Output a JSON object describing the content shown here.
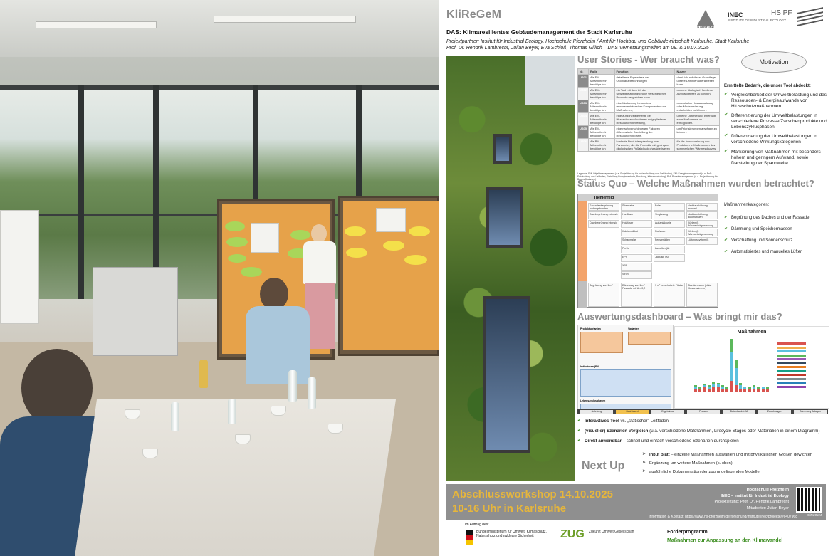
{
  "photo": {
    "description_hidden": ""
  },
  "poster": {
    "brand": "KliReGeM",
    "subtitle": "DAS: Klimaresilientes Gebäudemanagement der Stadt Karlsruhe",
    "partner_line": "Projektpartner: Institut für Industrial Ecology, Hochschule Pforzheim / Amt für Hochbau und Gebäudewirtschaft Karlsruhe, Stadt Karlsruhe",
    "author_line": "Prof. Dr. Hendrik Lambrecht, Julian Beyer, Eva Schloß, Thomas Gillich – DAS Vernetzungstreffen am 09. & 10.07.2025",
    "logos": {
      "karlsruhe": "Karlsruhe",
      "inec": "INEC",
      "inec_sub": "INSTITUTE OF INDUSTRIAL ECOLOGY",
      "hspf": "HS PF"
    },
    "sections": {
      "user_stories": "User Stories - Wer braucht was?",
      "status_quo": "Status Quo – Welche Maßnahmen wurden betrachtet?",
      "dashboard": "Auswertungsdashboard – Was bringt mir das?",
      "next_up": "Next Up"
    },
    "motivation": "Motivation",
    "user_story_table": {
      "headers": [
        "Nr.",
        "Rolle",
        "Funktion",
        "Nutzen"
      ],
      "rows": [
        [
          "US01",
          "Als EM-Mitarbeiter*in benötige ich",
          "detaillierte Ergebnisse der Ökobilanzberechnungen",
          "damit ich auf dieser Grundlage unsere Leitlinien überarbeiten kann."
        ],
        [
          "US02",
          "Als EM-Mitarbeiter*in benötige ich",
          "ein Tool mit dem ich die Umweltbelastungsprofile verschiedener Produkte vergleichen kann",
          "um eine ökologisch fundierte Auswahl treffen zu können."
        ],
        [
          "US03",
          "Als EM-Mitarbeiter*in benötige ich",
          "eine Markierung besonders ressourcenintensiver Komponenten von Maßnahmen,",
          "um zwischen Instandsetzung oder Modernisierung entscheiden zu können."
        ],
        [
          "US04",
          "Als EM-Mitarbeiter*in benötige ich",
          "eine auf Einzelelemente der Hitzeschutzmaßnahmen aufgegliederte Ressourcenbewertung,",
          "um eine Optimierung innerhalb einer Maßnahme zu ermöglichen."
        ],
        [
          "US05",
          "Als EM-Mitarbeiter*in benötige ich",
          "eine nach verschiedenen Faktoren differenzierte Darstellung der Ressourcenbedarfe,",
          "um Priorisierungen abwägen zu können."
        ],
        [
          "US06",
          "Als PM-Mitarbeiter*in benötige ich",
          "konkrete Produktempfehlung oder Parameter, die die Produkte mit geringem ökologischen Fußabdruck charakterisieren",
          "für die Ausschreibung von Produkten u. Maßnahmen des sommerlichen Wärmeschutzes."
        ]
      ],
      "legend": "Legende: EM: Objektmanagement (u.a. Projektierung für Instandhaltung von Gebäuden), EM: Energiemanagement (u.a. BnS: Entwicklung von Leitfaden, Erstellung Energieberichte, Beratung, Klimamonitoring), PM: Projektmanagement (u.a. Projektierung für Baumaßnahmen)"
    },
    "needs": {
      "heading": "Ermittelte Bedarfe, die unser Tool abdeckt:",
      "items": [
        "Vergleichbarkeit der Umweltbelastung und des Ressourcen- & Energieaufwands von Hitzeschutzmaßnahmen",
        "Differenzierung der Umweltbelastungen in verschiedene Prozesse/Zwischenprodukte und Lebenszyklusphasen",
        "Differenzierung der Umweltbelastungen in verschiedene Wirkungskategorien",
        "Markierung von Maßnahmen mit besonders hohem und geringem Aufwand, sowie Darstellung der Spannweite"
      ]
    },
    "status_grid": {
      "header": "Themenfeld",
      "columns": [
        "Begrünung",
        "Status",
        "Dämmung / Speichermasse",
        "Status",
        "Sonnenschutz",
        "Status",
        "Lüften",
        "Status"
      ],
      "rows": [
        [
          "Fassadenbegrünung bodengebunden",
          "Stiermatte",
          "Folie",
          "Nachtauskühlung manuell"
        ],
        [
          "Dachbegrünung extensiv",
          "Hanffaser",
          "Verglasung",
          "Nachtauskühlung automatisiert"
        ],
        [
          "Dachbegrünung intensiv",
          "Holzfaser",
          "Außenjalousie",
          "Kühlen (i) Wärmerückgewinnung"
        ],
        [
          "",
          "Kalziumsilikat",
          "Raffstore",
          "Kühlen (i) Wärmerückgewinnung"
        ],
        [
          "",
          "Schaumglas",
          "Fensterläden",
          "Lüftungssystem (i)"
        ],
        [
          "",
          "Perlite",
          "Lamellen (A)",
          ""
        ],
        [
          "",
          "EPS",
          "Jalousie (A)",
          ""
        ],
        [
          "",
          "XPS",
          "",
          ""
        ],
        [
          "",
          "Stroh",
          "",
          ""
        ]
      ],
      "unit_row": [
        "Begrünung von 1 m²",
        "Dämmung von 1 m² Fassade mit U = 0,2",
        "1 m² verschattete Fläche",
        "Standardraum (Nutz. Klassenzimmer)"
      ],
      "side_labels": [
        "Maßnahmen",
        "Bezugs-größe"
      ]
    },
    "categories": {
      "heading": "Maßnahmenkategorien:",
      "items": [
        "Begrünung des Daches und der Fassade",
        "Dämmung und Speichermassen",
        "Verschattung und Sonnenschutz",
        "Automatisiertes und manuelles Lüften"
      ]
    },
    "dashboard": {
      "left_headers": [
        "Produktvarianten",
        "Varianten",
        "Indikatoren (EN)",
        "Lebenszyklusphasen"
      ],
      "chart_title": "Maßnahmen",
      "tabs": [
        "Anleitung",
        "Dashboard",
        "Ergebnisse",
        "Phasen",
        "Datenbank LCA",
        "Zuordnungen",
        "Dämmung Anlagen"
      ]
    },
    "features": [
      {
        "bold": "Interaktives Tool",
        "rest": " vs. „statischer\" Leitfaden"
      },
      {
        "bold": "(visueller) Szenarien Vergleich",
        "rest": " (u.a. verschiedene Maßnahmen, Lifecycle Stages oder Materialien in einem Diagramm)"
      },
      {
        "bold": "Direkt anwendbar",
        "rest": " – schnell und einfach verschiedene Szenarien durchspielen"
      }
    ],
    "next_up": [
      {
        "bold": "Input Blatt",
        "rest": " – einzelne Maßnahmen auswählen und mit physikalischen Größen gewichten"
      },
      {
        "bold": "",
        "rest": "Ergänzung um weitere Maßnahmen (s. oben)"
      },
      {
        "bold": "",
        "rest": "ausführliche Dokumentation der zugrundeliegenden Modelle"
      }
    ],
    "workshop": {
      "line1": "Abschlussworkshop 14.10.2025",
      "line2": "10-16 Uhr in Karlsruhe"
    },
    "contact": {
      "org": "Hochschule Pforzheim",
      "institute": "INEC – Institut für Industrial Ecology",
      "lead": "Projektleitung: Prof. Dr. Hendrik Lambrecht",
      "staff": "Mitarbeiter: Julian Beyer",
      "url": "Information & Kontakt: https://www.hs-pforzheim.de/forschung/institute/inec/projekte/#c407968",
      "qr_label": "KliReGeM"
    },
    "funders": {
      "auftrag": "Im Auftrag des:",
      "bmu": "Bundesministerium für Umwelt, Klimaschutz, Naturschutz und nukleare Sicherheit",
      "zug": "ZUG",
      "zug_sub": "Zukunft Umwelt Gesellschaft",
      "programme_label": "Förderprogramm",
      "programme": "Maßnahmen zur Anpassung an den Klimawandel"
    }
  },
  "colors": {
    "section_grey": "#8b8b8b",
    "workshop_gold": "#e7b63b",
    "check_green": "#3a8c1e",
    "footer_grey": "#8f8f8f"
  },
  "chart_data": {
    "type": "bar",
    "title": "Maßnahmen",
    "categories": [
      "M1",
      "M2",
      "M3",
      "M4",
      "M5",
      "M6",
      "M7",
      "M8",
      "M9",
      "M10",
      "M11",
      "M12",
      "M13",
      "M14",
      "M15",
      "M16",
      "M17"
    ],
    "series": [
      {
        "values": [
          0.3,
          0.2,
          0.4,
          0.3,
          0.5,
          0.4,
          0.3,
          0.2,
          1.0,
          0.6,
          0.3,
          0.2,
          0.2,
          0.3,
          0.2,
          0.3,
          0.2
        ]
      },
      {
        "values": [
          0.2,
          0.1,
          0.2,
          0.2,
          0.2,
          0.3,
          0.2,
          0.1,
          2.8,
          1.6,
          0.3,
          0.2,
          0.1,
          0.2,
          0.1,
          0.1,
          0.1
        ]
      },
      {
        "values": [
          0.1,
          0.1,
          0.1,
          0.1,
          0.2,
          0.1,
          0.1,
          0.1,
          1.2,
          0.8,
          0.2,
          0.1,
          0.1,
          0.1,
          0.1,
          0.1,
          0.1
        ]
      }
    ]
  }
}
